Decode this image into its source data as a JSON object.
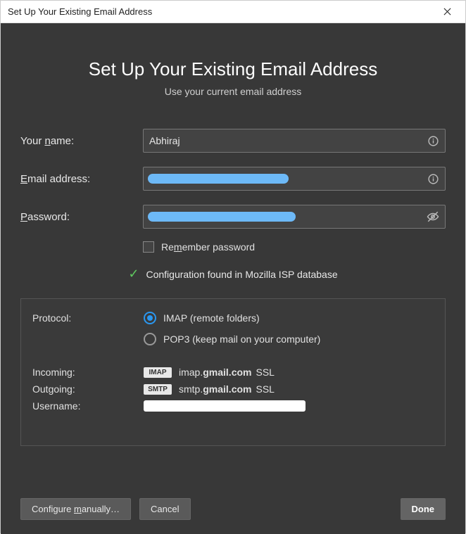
{
  "titlebar": {
    "title": "Set Up Your Existing Email Address"
  },
  "header": {
    "title": "Set Up Your Existing Email Address",
    "subtitle": "Use your current email address"
  },
  "form": {
    "name_label_pre": "Your ",
    "name_label_u": "n",
    "name_label_post": "ame:",
    "name_value": "Abhiraj",
    "email_label_u": "E",
    "email_label_post": "mail address:",
    "password_label_u": "P",
    "password_label_post": "assword:",
    "remember_pre": "Re",
    "remember_u": "m",
    "remember_post": "ember password"
  },
  "status": {
    "text": "Configuration found in Mozilla ISP database"
  },
  "details": {
    "protocol_label": "Protocol:",
    "imap_label": "IMAP (remote folders)",
    "pop3_label": "POP3 (keep mail on your computer)",
    "incoming_label": "Incoming:",
    "outgoing_label": "Outgoing:",
    "username_label": "Username:",
    "imap_badge": "IMAP",
    "smtp_badge": "SMTP",
    "incoming_pre": "imap.",
    "incoming_bold": "gmail.com",
    "outgoing_pre": "smtp.",
    "outgoing_bold": "gmail.com",
    "ssl": "SSL"
  },
  "buttons": {
    "configure_pre": "Configure ",
    "configure_u": "m",
    "configure_post": "anually…",
    "cancel": "Cancel",
    "done": "Done"
  }
}
